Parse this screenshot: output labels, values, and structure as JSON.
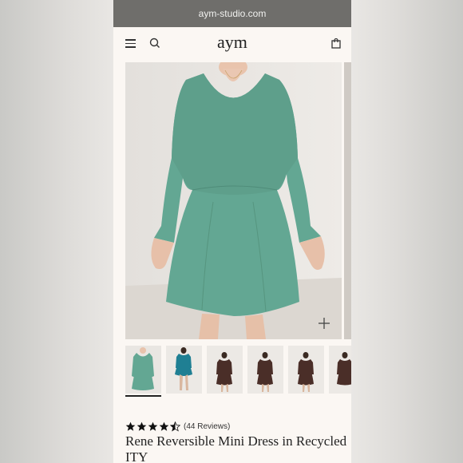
{
  "browser": {
    "url": "aym-studio.com"
  },
  "header": {
    "logo": "aym",
    "menu_icon": "hamburger-menu-icon",
    "search_icon": "search-icon",
    "cart_icon": "shopping-bag-icon"
  },
  "gallery": {
    "zoom_icon": "plus-icon",
    "thumbnails": [
      {
        "name": "thumb-green-front",
        "color": "#5f9e8a"
      },
      {
        "name": "thumb-teal-full",
        "color": "#1f7f93"
      },
      {
        "name": "thumb-brown-1",
        "color": "#4a2e28"
      },
      {
        "name": "thumb-brown-2",
        "color": "#4a2e28"
      },
      {
        "name": "thumb-brown-3",
        "color": "#4a2e28"
      },
      {
        "name": "thumb-brown-4",
        "color": "#4a2e28"
      }
    ]
  },
  "product": {
    "rating": 4.5,
    "reviews_label": "(44 Reviews)",
    "title": "Rene Reversible Mini Dress in Recycled ITY"
  },
  "colors": {
    "dress_green": "#63a793",
    "page_bg": "#fbf7f3",
    "url_bar": "#6f6e6b"
  }
}
